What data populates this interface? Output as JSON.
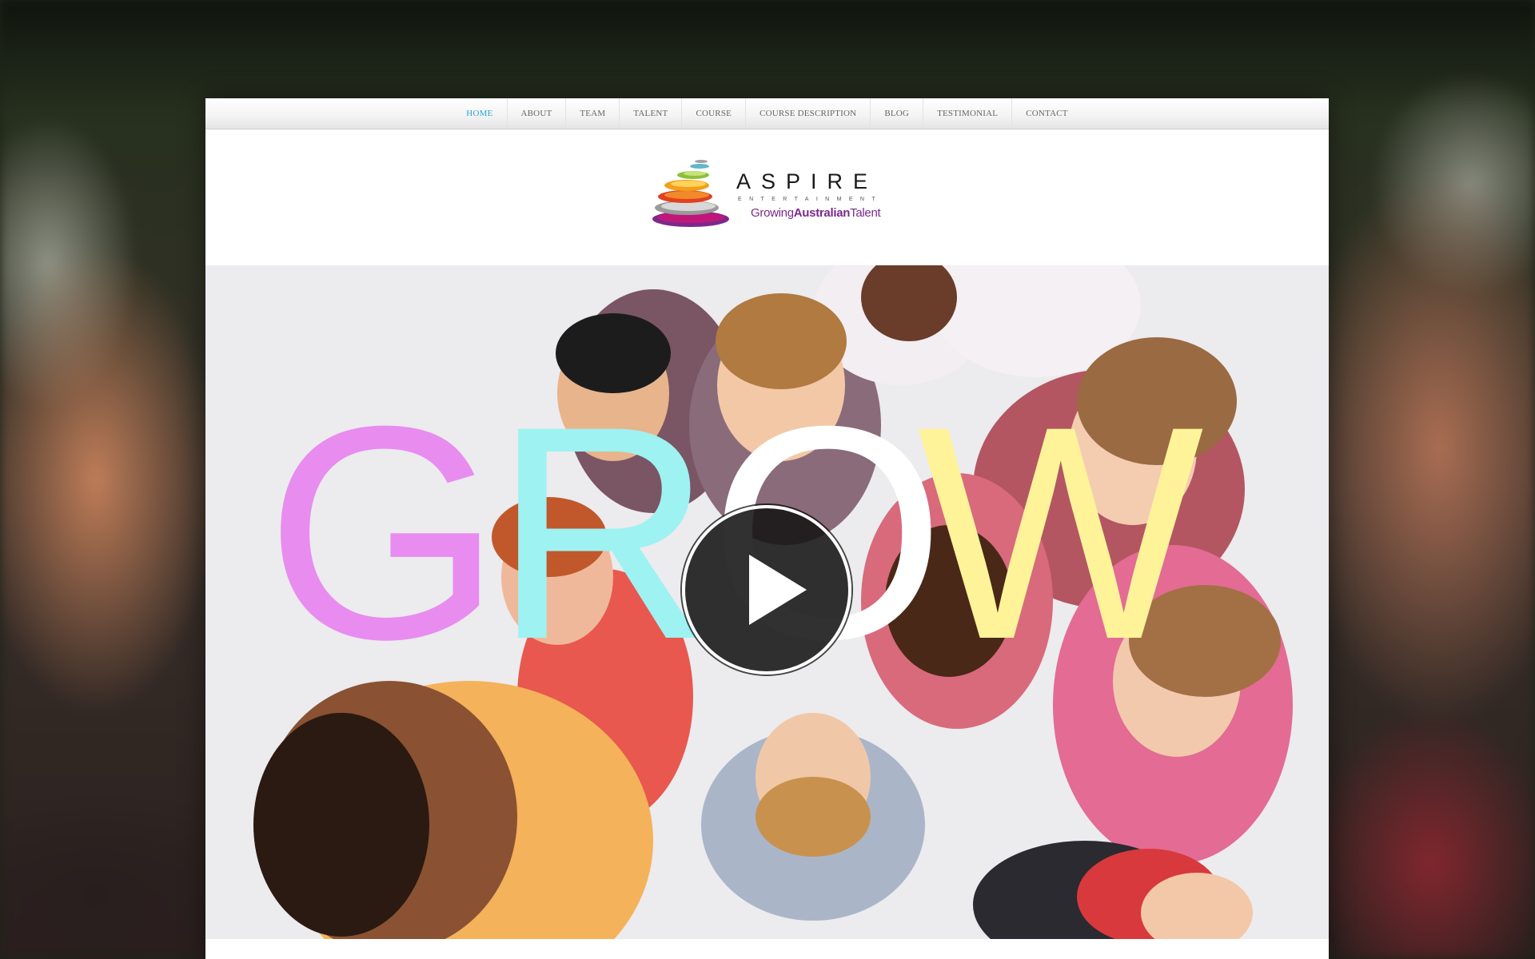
{
  "nav": {
    "items": [
      {
        "label": "HOME",
        "active": true
      },
      {
        "label": "ABOUT",
        "active": false
      },
      {
        "label": "TEAM",
        "active": false
      },
      {
        "label": "TALENT",
        "active": false
      },
      {
        "label": "COURSE",
        "active": false
      },
      {
        "label": "COURSE DESCRIPTION",
        "active": false
      },
      {
        "label": "BLOG",
        "active": false
      },
      {
        "label": "TESTIMONIAL",
        "active": false
      },
      {
        "label": "CONTACT",
        "active": false
      }
    ],
    "active_color": "#2aa3d6"
  },
  "logo": {
    "name": "ASPIRE",
    "subtitle": "ENTERTAINMENT",
    "tagline_part1": "Growing",
    "tagline_part2": "Australian",
    "tagline_part3": "Talent",
    "tagline_color": "#7b2a8c"
  },
  "video": {
    "overlay_letters": [
      {
        "char": "G",
        "color": "#e88cf0"
      },
      {
        "char": "R",
        "color": "#9ef2f2"
      },
      {
        "char": "O",
        "color": "#ffffff"
      },
      {
        "char": "W",
        "color": "#fff39a"
      }
    ],
    "play_icon": "play-icon"
  }
}
